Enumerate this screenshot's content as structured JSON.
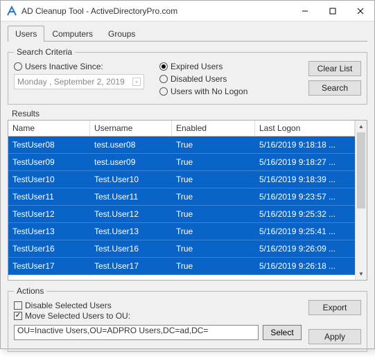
{
  "window": {
    "title": "AD Cleanup Tool - ActiveDirectoryPro.com"
  },
  "tabs": {
    "users": "Users",
    "computers": "Computers",
    "groups": "Groups"
  },
  "criteria": {
    "legend": "Search Criteria",
    "inactive_since": "Users Inactive Since:",
    "date": "Monday  , September  2, 2019",
    "expired": "Expired Users",
    "disabled": "Disabled Users",
    "nologon": "Users with No Logon",
    "clear": "Clear List",
    "search": "Search"
  },
  "results": {
    "label": "Results",
    "headers": {
      "name": "Name",
      "username": "Username",
      "enabled": "Enabled",
      "lastlogon": "Last Logon"
    },
    "rows": [
      {
        "name": "TestUser08",
        "username": "test.user08",
        "enabled": "True",
        "lastlogon": "5/16/2019 9:18:18 ..."
      },
      {
        "name": "TestUser09",
        "username": "test.user09",
        "enabled": "True",
        "lastlogon": "5/16/2019 9:18:27 ..."
      },
      {
        "name": "TestUser10",
        "username": "Test.User10",
        "enabled": "True",
        "lastlogon": "5/16/2019 9:18:39 ..."
      },
      {
        "name": "TestUser11",
        "username": "Test.User11",
        "enabled": "True",
        "lastlogon": "5/16/2019 9:23:57 ..."
      },
      {
        "name": "TestUser12",
        "username": "Test.User12",
        "enabled": "True",
        "lastlogon": "5/16/2019 9:25:32 ..."
      },
      {
        "name": "TestUser13",
        "username": "Test.User13",
        "enabled": "True",
        "lastlogon": "5/16/2019 9:25:41 ..."
      },
      {
        "name": "TestUser16",
        "username": "Test.User16",
        "enabled": "True",
        "lastlogon": "5/16/2019 9:26:09 ..."
      },
      {
        "name": "TestUser17",
        "username": "Test.User17",
        "enabled": "True",
        "lastlogon": "5/16/2019 9:26:18 ..."
      }
    ]
  },
  "actions": {
    "legend": "Actions",
    "disable": "Disable Selected Users",
    "move": "Move Selected Users to OU:",
    "ou": "OU=Inactive Users,OU=ADPRO Users,DC=ad,DC=",
    "select": "Select",
    "export": "Export",
    "apply": "Apply"
  }
}
